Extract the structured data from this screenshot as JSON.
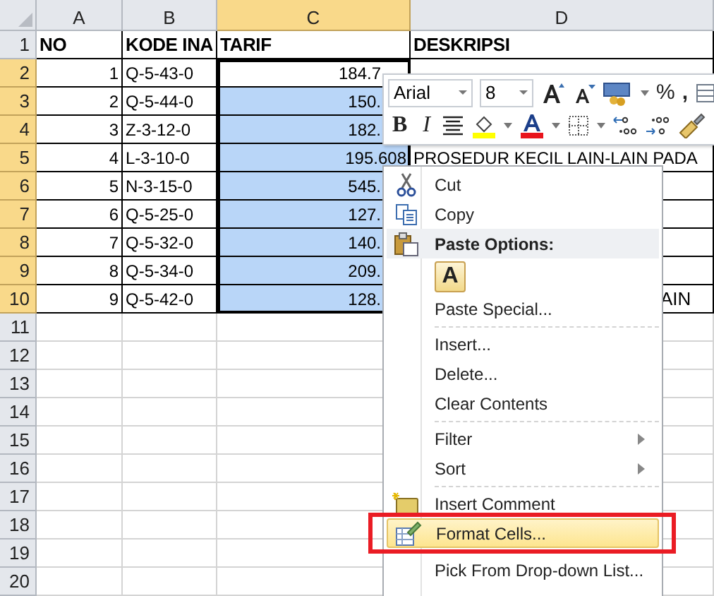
{
  "columns": [
    {
      "label": "A",
      "selected": false
    },
    {
      "label": "B",
      "selected": false
    },
    {
      "label": "C",
      "selected": true
    },
    {
      "label": "D",
      "selected": false
    }
  ],
  "rows": [
    {
      "num": "1",
      "selected": false,
      "cells": [
        "NO",
        "KODE INA",
        "TARIF",
        "DESKRIPSI"
      ]
    },
    {
      "num": "2",
      "selected": true,
      "cells": [
        "1",
        "Q-5-43-0",
        "184.7",
        ""
      ]
    },
    {
      "num": "3",
      "selected": true,
      "cells": [
        "2",
        "Q-5-44-0",
        "150.",
        ""
      ]
    },
    {
      "num": "4",
      "selected": true,
      "cells": [
        "3",
        "Z-3-12-0",
        "182.",
        ""
      ]
    },
    {
      "num": "5",
      "selected": true,
      "cells": [
        "4",
        "L-3-10-0",
        "195.608",
        "PROSEDUR KECIL LAIN-LAIN PADA"
      ]
    },
    {
      "num": "6",
      "selected": true,
      "cells": [
        "5",
        "N-3-15-0",
        "545.",
        ""
      ]
    },
    {
      "num": "7",
      "selected": true,
      "cells": [
        "6",
        "Q-5-25-0",
        "127.",
        ""
      ]
    },
    {
      "num": "8",
      "selected": true,
      "cells": [
        "7",
        "Q-5-32-0",
        "140.",
        ""
      ]
    },
    {
      "num": "9",
      "selected": true,
      "cells": [
        "8",
        "Q-5-34-0",
        "209.",
        ""
      ]
    },
    {
      "num": "10",
      "selected": true,
      "cells": [
        "9",
        "Q-5-42-0",
        "128.",
        "AIN"
      ]
    },
    {
      "num": "11",
      "selected": false
    },
    {
      "num": "12",
      "selected": false
    },
    {
      "num": "13",
      "selected": false
    },
    {
      "num": "14",
      "selected": false
    },
    {
      "num": "15",
      "selected": false
    },
    {
      "num": "16",
      "selected": false
    },
    {
      "num": "17",
      "selected": false
    },
    {
      "num": "18",
      "selected": false
    },
    {
      "num": "19",
      "selected": false
    },
    {
      "num": "20",
      "selected": false
    }
  ],
  "mini_toolbar": {
    "font": "Arial",
    "size": "8",
    "percent": "%",
    "comma": ",",
    "bold": "B",
    "italic": "I"
  },
  "context_menu": [
    {
      "kind": "item",
      "label": "Cut"
    },
    {
      "kind": "item",
      "label": "Copy"
    },
    {
      "kind": "header",
      "label": "Paste Options:"
    },
    {
      "kind": "paste",
      "label": "A"
    },
    {
      "kind": "item",
      "label": "Paste Special..."
    },
    {
      "kind": "separator"
    },
    {
      "kind": "item",
      "label": "Insert..."
    },
    {
      "kind": "item",
      "label": "Delete..."
    },
    {
      "kind": "item",
      "label": "Clear Contents"
    },
    {
      "kind": "separator"
    },
    {
      "kind": "submenu",
      "label": "Filter"
    },
    {
      "kind": "submenu",
      "label": "Sort"
    },
    {
      "kind": "separator"
    },
    {
      "kind": "item",
      "label": "Insert Comment"
    },
    {
      "kind": "item",
      "label": "Format Cells...",
      "highlighted": true
    },
    {
      "kind": "item",
      "label": "Pick From Drop-down List..."
    }
  ]
}
